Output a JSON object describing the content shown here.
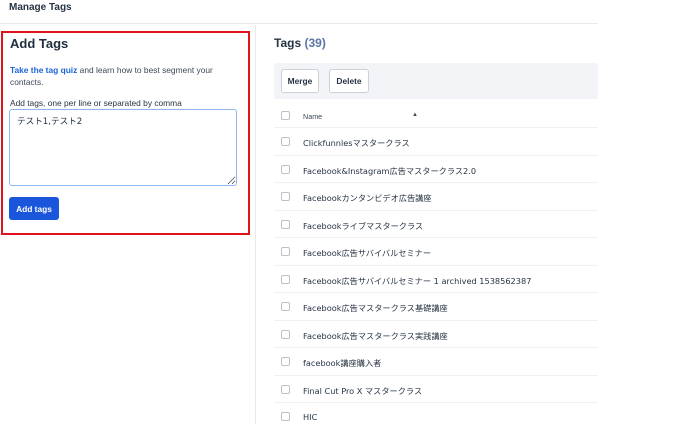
{
  "topbar": {
    "title": "Manage Tags"
  },
  "add_panel": {
    "title": "Add Tags",
    "quiz_link": "Take the tag quiz",
    "intro_rest": " and learn how to best segment your contacts.",
    "field_label": "Add tags, one per line or separated by comma",
    "input_value": "テスト1,テスト2",
    "add_button": "Add tags"
  },
  "tags_panel": {
    "title": "Tags",
    "count": "(39)",
    "merge_button": "Merge",
    "delete_button": "Delete",
    "column_name": "Name",
    "rows": [
      "Clickfunnlesマスタークラス",
      "Facebook&Instagram広告マスタークラス2.0",
      "Facebookカンタンビデオ広告講座",
      "Facebookライブマスタークラス",
      "Facebook広告サバイバルセミナー",
      "Facebook広告サバイバルセミナー 1 archived 1538562387",
      "Facebook広告マスタークラス基礎講座",
      "Facebook広告マスタークラス実践講座",
      "facebook講座購入者",
      "Final Cut Pro X マスタークラス",
      "HIC"
    ]
  },
  "colors": {
    "accent": "#1a56db",
    "highlight": "#e0121b",
    "link": "#1b64d8"
  },
  "icons": {
    "sort": "sort-ascending-icon",
    "resize": "resize-grip-icon"
  }
}
